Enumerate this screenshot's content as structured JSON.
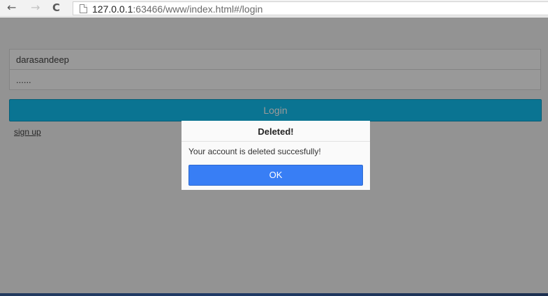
{
  "browser": {
    "back_glyph": "←",
    "forward_glyph": "→",
    "reload_glyph": "C",
    "url_host": "127.0.0.1",
    "url_rest": ":63466/www/index.html#/login"
  },
  "login_form": {
    "username_value": "darasandeep",
    "password_value": "......",
    "login_button": "Login",
    "signup_link": "sign up"
  },
  "popup": {
    "title": "Deleted!",
    "message": "Your account is deleted succesfully!",
    "ok_button": "OK"
  },
  "colors": {
    "login_button": "#11c1f3",
    "ok_button": "#387ef5",
    "overlay": "rgba(0,0,0,0.4)"
  }
}
